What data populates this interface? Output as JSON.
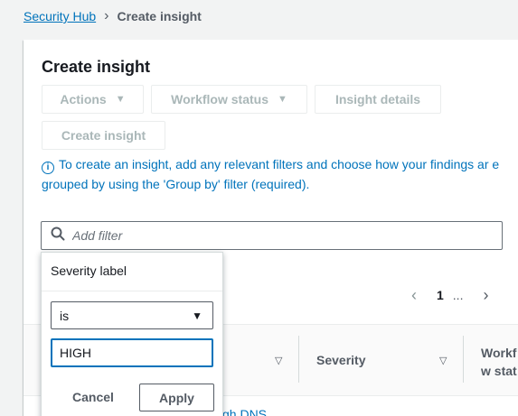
{
  "breadcrumb": {
    "root": "Security Hub",
    "current": "Create insight"
  },
  "page": {
    "title": "Create insight"
  },
  "toolbar": {
    "actions_label": "Actions",
    "workflow_status_label": "Workflow status",
    "insight_details_label": "Insight details",
    "create_insight_label": "Create insight"
  },
  "info": {
    "text": "To create an insight, add any relevant filters and choose how your findings ar e grouped by using the 'Group by' filter (required)."
  },
  "filter": {
    "placeholder": "Add filter"
  },
  "pagination": {
    "page": "1",
    "more": "..."
  },
  "table": {
    "columns": [
      "Severity",
      "Workf w stat"
    ],
    "row_link_partial": "gh DNS"
  },
  "dropdown": {
    "title": "Severity label",
    "operator": "is",
    "value": "HIGH",
    "cancel_label": "Cancel",
    "apply_label": "Apply"
  },
  "colors": {
    "link": "#0073bb",
    "focus": "#0073bb",
    "disabled": "#aab7b8"
  },
  "icons": [
    "chevron-right-icon",
    "caret-down-icon",
    "info-icon",
    "search-icon",
    "chevron-left-icon",
    "sort-icon"
  ]
}
